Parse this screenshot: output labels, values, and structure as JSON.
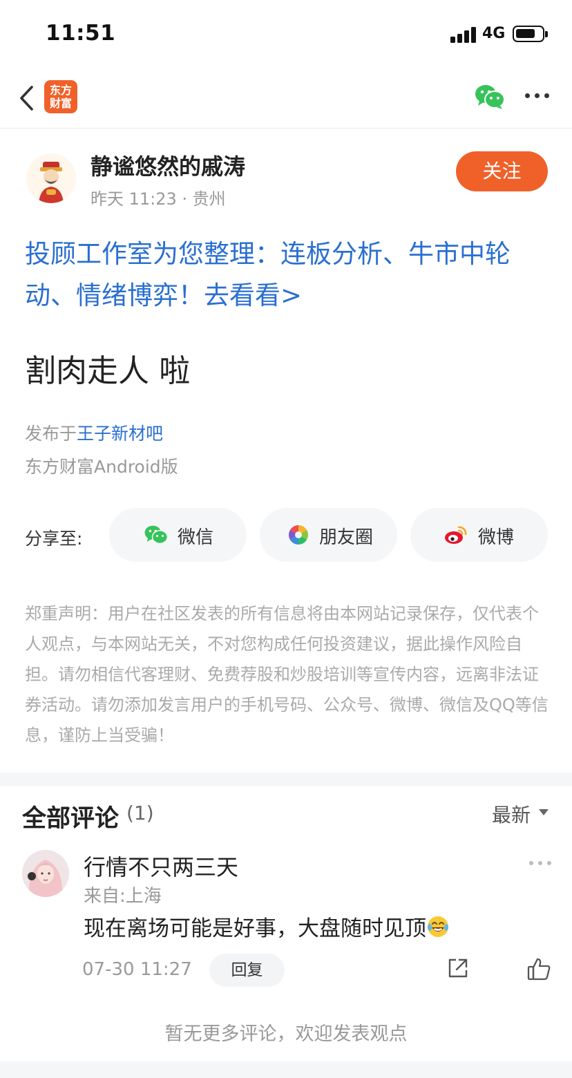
{
  "status_bar": {
    "time": "11:51",
    "network": "4G"
  },
  "nav": {
    "app_logo_text_1": "东方",
    "app_logo_text_2": "财富",
    "icons": [
      "back-icon",
      "wechat-icon",
      "more-icon"
    ]
  },
  "author": {
    "name": "静谧悠然的戚涛",
    "meta": "昨天 11:23 · 贵州",
    "follow_label": "关注"
  },
  "promo": {
    "text": "投顾工作室为您整理：连板分析、牛市中轮动、情绪博弈！去看看>"
  },
  "post": {
    "title": "割肉走人 啦",
    "published_prefix": "发布于",
    "forum": "王子新材吧",
    "client": "东方财富Android版"
  },
  "share": {
    "label": "分享至:",
    "options": [
      {
        "label": "微信",
        "icon": "wechat-icon"
      },
      {
        "label": "朋友圈",
        "icon": "moments-icon"
      },
      {
        "label": "微博",
        "icon": "weibo-icon"
      }
    ]
  },
  "disclaimer": "郑重声明：用户在社区发表的所有信息将由本网站记录保存，仅代表个人观点，与本网站无关，不对您构成任何投资建议，据此操作风险自担。请勿相信代客理财、免费荐股和炒股培训等宣传内容，远离非法证券活动。请勿添加发言用户的手机号码、公众号、微博、微信及QQ等信息，谨防上当受骗！",
  "comments": {
    "title": "全部评论",
    "count": "(1)",
    "sort": "最新",
    "items": [
      {
        "user": "行情不只两三天",
        "location": "来自:上海",
        "text": "现在离场可能是好事，大盘随时见顶",
        "time": "07-30 11:27",
        "reply_label": "回复"
      }
    ],
    "no_more": "暂无更多评论，欢迎发表观点"
  },
  "colors": {
    "accent": "#f0612a",
    "link": "#2a6fd1",
    "muted": "#999999",
    "wechat": "#36c35a"
  }
}
